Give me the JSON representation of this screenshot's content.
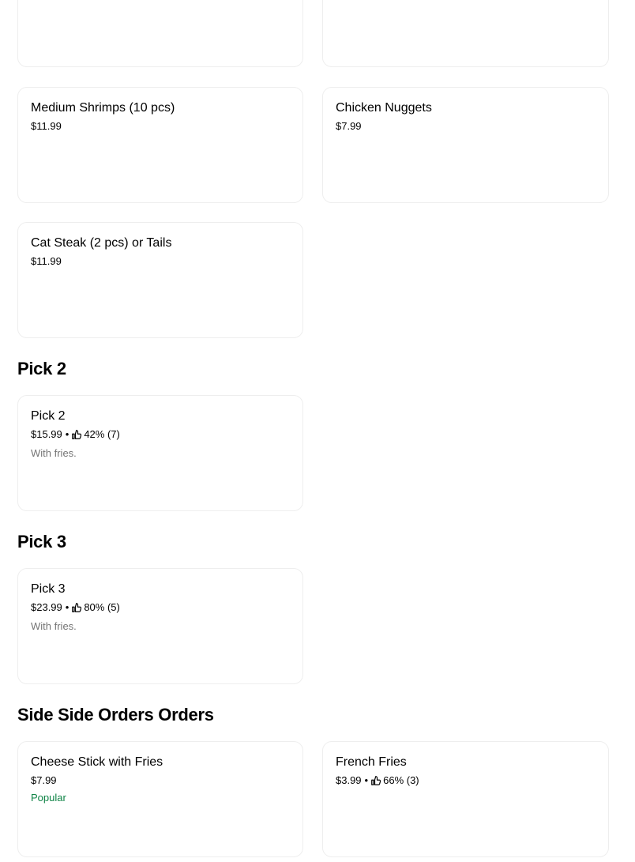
{
  "menu": {
    "items": [
      {
        "name": "Medium Shrimps (10 pcs)",
        "price": "$11.99"
      },
      {
        "name": "Chicken Nuggets",
        "price": "$7.99"
      },
      {
        "name": "Cat Steak (2 pcs) or Tails",
        "price": "$11.99"
      }
    ]
  },
  "sections": [
    {
      "title": "Pick 2",
      "items": [
        {
          "name": "Pick 2",
          "price": "$15.99",
          "separator": "•",
          "rating": "42% (7)",
          "description": "With fries."
        }
      ]
    },
    {
      "title": "Pick 3",
      "items": [
        {
          "name": "Pick 3",
          "price": "$23.99",
          "separator": "•",
          "rating": "80% (5)",
          "description": "With fries."
        }
      ]
    },
    {
      "title": "Side Side Orders Orders",
      "items": [
        {
          "name": "Cheese Stick with Fries",
          "price": "$7.99",
          "badge": "Popular"
        },
        {
          "name": "French Fries",
          "price": "$3.99",
          "separator": "•",
          "rating": "66% (3)"
        }
      ]
    }
  ],
  "colors": {
    "popular_badge": "#0e8345",
    "description_text": "#757575",
    "card_border": "#eeeeee"
  },
  "icons": {
    "rating": "thumbs-up-icon"
  }
}
